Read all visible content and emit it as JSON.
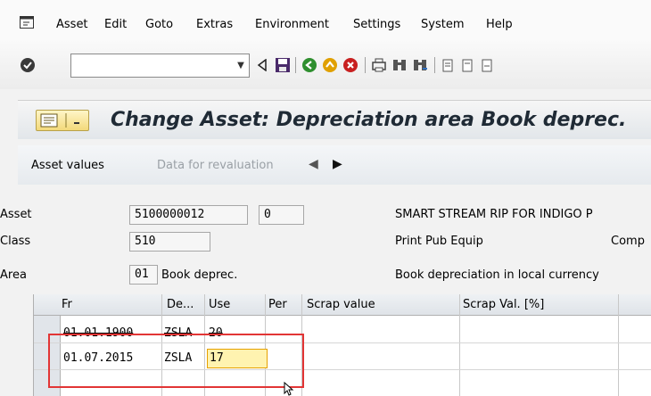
{
  "menu": {
    "items": [
      "Asset",
      "Edit",
      "Goto",
      "Extras",
      "Environment",
      "Settings",
      "System",
      "Help"
    ]
  },
  "toolbar": {
    "command_field_value": "",
    "icons": [
      "check-icon",
      "back-arrow-icon",
      "save-icon",
      "back-green-icon",
      "exit-icon",
      "cancel-icon",
      "print-icon",
      "find-icon",
      "find-next-icon",
      "first-page-icon",
      "prev-page-icon",
      "next-page-icon"
    ]
  },
  "title": {
    "text": "Change Asset: Depreciation area Book deprec."
  },
  "app_toolbar": {
    "asset_values": "Asset values",
    "data_for_revaluation": "Data for revaluation"
  },
  "header": {
    "asset_label": "Asset",
    "asset_number": "5100000012",
    "asset_sub": "0",
    "asset_desc": "SMART STREAM RIP FOR INDIGO P",
    "class_label": "Class",
    "class_value": "510",
    "class_desc": "Print Pub Equip",
    "class_extra": "Comp",
    "area_label": "Area",
    "area_value": "01",
    "area_name": "Book deprec.",
    "area_desc": "Book depreciation in local currency"
  },
  "table": {
    "columns": [
      "Fr",
      "De...",
      "Use",
      "Per",
      "Scrap value",
      "Scrap Val. [%]"
    ],
    "rows": [
      {
        "from": "01.01.1900",
        "dep_key": "ZSLA",
        "use": "20",
        "per": "",
        "scrap_value": "",
        "scrap_pct": ""
      },
      {
        "from": "01.07.2015",
        "dep_key": "ZSLA",
        "use": "17",
        "per": "",
        "scrap_value": "",
        "scrap_pct": ""
      }
    ]
  },
  "colors": {
    "highlight": "#e23535",
    "active_cell": "#fff3b0"
  }
}
